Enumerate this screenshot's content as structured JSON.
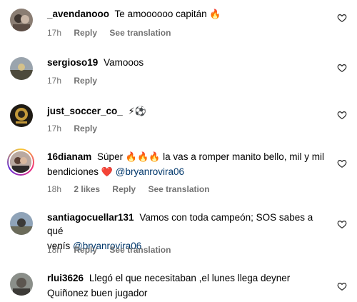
{
  "comments": [
    {
      "username": "_avendanooo",
      "text": "Te amoooooo capitán",
      "emoji": "🔥",
      "time": "17h",
      "reply": "Reply",
      "see_translation": "See translation"
    },
    {
      "username": "sergioso19",
      "text": "Vamooos",
      "time": "17h",
      "reply": "Reply"
    },
    {
      "username": "just_soccer_co_",
      "text": "",
      "emoji": "⚡⚽",
      "time": "17h",
      "reply": "Reply"
    },
    {
      "username": "16dianam",
      "text_a": "Súper",
      "emoji_a": "🔥🔥🔥",
      "text_b": "la vas a romper manito bello, mil y mil",
      "text_c": "bendiciones",
      "emoji_c": "❤️",
      "mention": "@bryanrovira06",
      "time": "18h",
      "likes": "2 likes",
      "reply": "Reply",
      "see_translation": "See translation"
    },
    {
      "username": "santiagocuellar131",
      "text_a": "Vamos con toda campeón; SOS sabes a qué",
      "text_b": "venís",
      "mention": "@bryanrovira06",
      "time": "18h",
      "reply": "Reply",
      "see_translation": "See translation"
    },
    {
      "username": "rlui3626",
      "text_a": "Llegó el que necesitaban ,el lunes llega deyner",
      "text_b": "Quiñonez buen jugador"
    }
  ],
  "icons": {
    "like": "heart-outline-icon"
  }
}
